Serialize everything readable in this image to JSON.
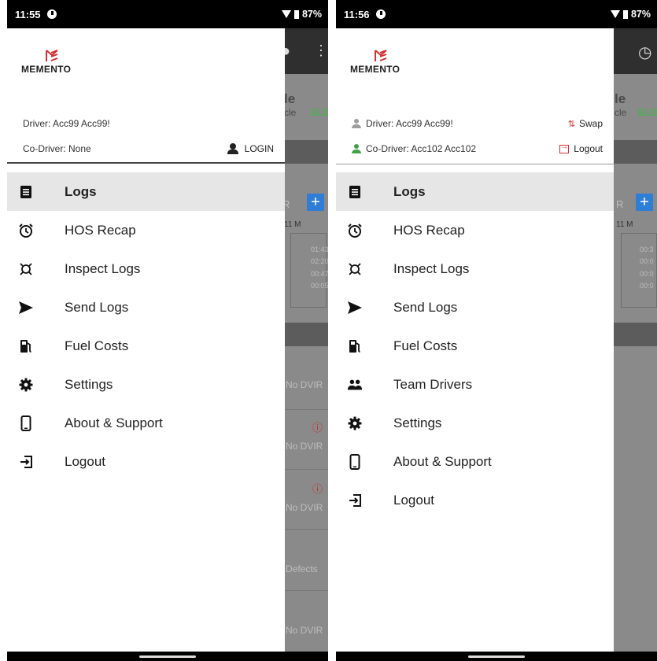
{
  "brand": {
    "name": "MEMENTO",
    "accent": "#d32f2f"
  },
  "left": {
    "status": {
      "time": "11:55",
      "battery": "87%"
    },
    "driver_label": "Driver: Acc99 Acc99!",
    "codriver_label": "Co-Driver: None",
    "login_label": "LOGIN",
    "menu": [
      {
        "label": "Logs",
        "icon": "logs-icon",
        "active": true
      },
      {
        "label": "HOS Recap",
        "icon": "alarm-clock-icon"
      },
      {
        "label": "Inspect Logs",
        "icon": "inspect-icon"
      },
      {
        "label": "Send Logs",
        "icon": "send-icon"
      },
      {
        "label": "Fuel Costs",
        "icon": "fuel-pump-icon"
      },
      {
        "label": "Settings",
        "icon": "gear-icon"
      },
      {
        "label": "About & Support",
        "icon": "phone-icon"
      },
      {
        "label": "Logout",
        "icon": "logout-icon"
      }
    ],
    "background": {
      "title_fragment": "le",
      "subtitle_fragment": "cle",
      "eld": "ELD",
      "r_fragment": "R",
      "hours_header": "11 M",
      "times": [
        "01:43",
        "02:20",
        "00:47",
        "00:05"
      ],
      "dvir_rows": [
        "No DVIR",
        "No DVIR",
        "No DVIR",
        "Defects",
        "No DVIR"
      ]
    }
  },
  "right": {
    "status": {
      "time": "11:56",
      "battery": "87%"
    },
    "driver_label": "Driver: Acc99 Acc99!",
    "codriver_label": "Co-Driver: Acc102 Acc102",
    "swap_label": "Swap",
    "logout_label": "Logout",
    "menu": [
      {
        "label": "Logs",
        "icon": "logs-icon",
        "active": true
      },
      {
        "label": "HOS Recap",
        "icon": "alarm-clock-icon"
      },
      {
        "label": "Inspect Logs",
        "icon": "inspect-icon"
      },
      {
        "label": "Send Logs",
        "icon": "send-icon"
      },
      {
        "label": "Fuel Costs",
        "icon": "fuel-pump-icon"
      },
      {
        "label": "Team Drivers",
        "icon": "team-icon"
      },
      {
        "label": "Settings",
        "icon": "gear-icon"
      },
      {
        "label": "About & Support",
        "icon": "phone-icon"
      },
      {
        "label": "Logout",
        "icon": "logout-icon"
      }
    ],
    "background": {
      "title_fragment": "le",
      "subtitle_fragment": "cle",
      "eld": "ELD",
      "r_fragment": "R",
      "hours_header": "11 M",
      "times": [
        "00:3",
        "00:0",
        "00:0",
        "00:0"
      ]
    }
  }
}
